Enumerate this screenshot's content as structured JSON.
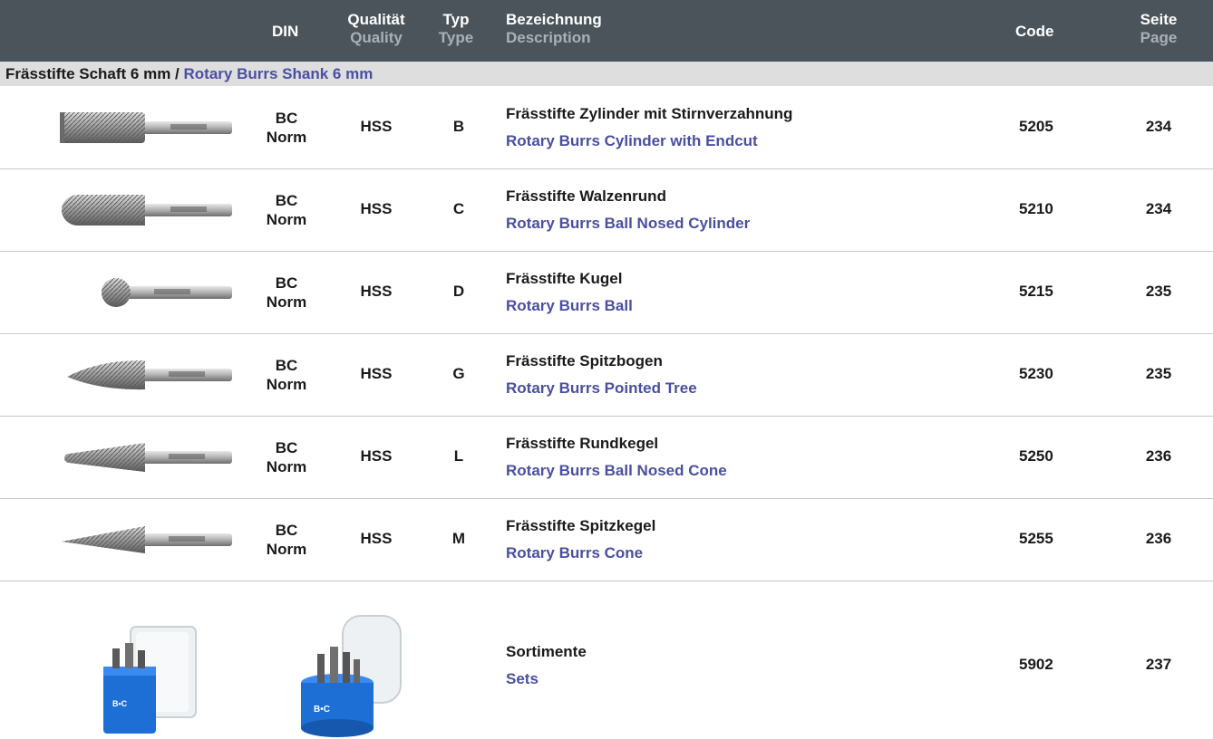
{
  "header": {
    "din": "DIN",
    "qual_de": "Qualität",
    "qual_en": "Quality",
    "typ_de": "Typ",
    "typ_en": "Type",
    "bez_de": "Bezeichnung",
    "bez_en": "Description",
    "code": "Code",
    "seite_de": "Seite",
    "seite_en": "Page"
  },
  "section": {
    "de": "Frässtifte Schaft 6 mm / ",
    "en": "Rotary Burrs Shank 6 mm"
  },
  "rows": [
    {
      "din1": "BC",
      "din2": "Norm",
      "qual": "HSS",
      "typ": "B",
      "de": "Frässtifte Zylinder mit Stirnverzahnung",
      "en": "Rotary Burrs Cylinder with Endcut",
      "code": "5205",
      "page": "234",
      "icon": "cylinder-burr-icon"
    },
    {
      "din1": "BC",
      "din2": "Norm",
      "qual": "HSS",
      "typ": "C",
      "de": "Frässtifte Walzenrund",
      "en": "Rotary Burrs Ball Nosed Cylinder",
      "code": "5210",
      "page": "234",
      "icon": "ball-nosed-cylinder-burr-icon"
    },
    {
      "din1": "BC",
      "din2": "Norm",
      "qual": "HSS",
      "typ": "D",
      "de": "Frässtifte Kugel",
      "en": "Rotary Burrs Ball",
      "code": "5215",
      "page": "235",
      "icon": "ball-burr-icon"
    },
    {
      "din1": "BC",
      "din2": "Norm",
      "qual": "HSS",
      "typ": "G",
      "de": "Frässtifte Spitzbogen",
      "en": "Rotary Burrs Pointed Tree",
      "code": "5230",
      "page": "235",
      "icon": "pointed-tree-burr-icon"
    },
    {
      "din1": "BC",
      "din2": "Norm",
      "qual": "HSS",
      "typ": "L",
      "de": "Frässtifte Rundkegel",
      "en": "Rotary Burrs Ball Nosed Cone",
      "code": "5250",
      "page": "236",
      "icon": "ball-nosed-cone-burr-icon"
    },
    {
      "din1": "BC",
      "din2": "Norm",
      "qual": "HSS",
      "typ": "M",
      "de": "Frässtifte Spitzkegel",
      "en": "Rotary Burrs Cone",
      "code": "5255",
      "page": "236",
      "icon": "cone-burr-icon"
    }
  ],
  "sets": {
    "de": "Sortimente",
    "en": "Sets",
    "code": "5902",
    "page": "237",
    "icons": [
      "square-set-box-icon",
      "round-set-box-icon"
    ]
  },
  "colors": {
    "header_bg": "#4b545b",
    "header_sub": "#aab0b5",
    "section_bg": "#dedede",
    "english_text": "#4a4fa0",
    "set_box_blue": "#1d6fd6"
  }
}
